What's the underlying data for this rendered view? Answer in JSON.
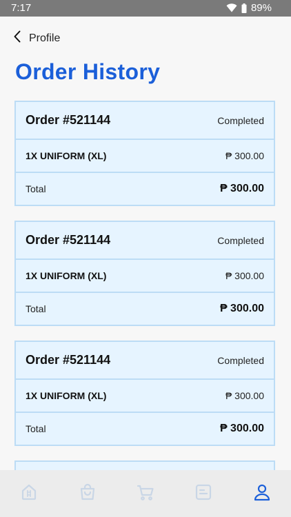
{
  "status_bar": {
    "time": "7:17",
    "battery": "89%"
  },
  "header": {
    "back_label": "Profile",
    "title": "Order History"
  },
  "orders": [
    {
      "id": "Order #521144",
      "status": "Completed",
      "item": "1X UNIFORM (XL)",
      "item_price": "₱ 300.00",
      "total_label": "Total",
      "total_value": "₱ 300.00"
    },
    {
      "id": "Order #521144",
      "status": "Completed",
      "item": "1X UNIFORM (XL)",
      "item_price": "₱ 300.00",
      "total_label": "Total",
      "total_value": "₱ 300.00"
    },
    {
      "id": "Order #521144",
      "status": "Completed",
      "item": "1X UNIFORM (XL)",
      "item_price": "₱ 300.00",
      "total_label": "Total",
      "total_value": "₱ 300.00"
    }
  ],
  "bottom_nav": {
    "items": [
      {
        "icon": "home-icon",
        "active": false
      },
      {
        "icon": "bag-icon",
        "active": false
      },
      {
        "icon": "cart-icon",
        "active": false
      },
      {
        "icon": "orders-icon",
        "active": false
      },
      {
        "icon": "profile-icon",
        "active": true
      }
    ]
  },
  "colors": {
    "accent": "#1b5fd9",
    "card_bg": "#e6f4ff",
    "card_border": "#bcdcf5",
    "nav_inactive": "#c9d6e6"
  }
}
